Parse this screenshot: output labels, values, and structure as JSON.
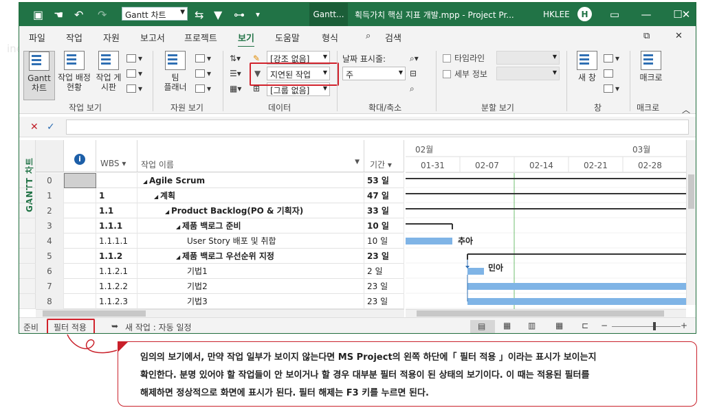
{
  "titlebar": {
    "view_combo": "Gantt 차트",
    "active_tab": "Gantt...",
    "file_title": "획득가치 핵심 지표 개발.mpp - Project Pr...",
    "user": "HKLEE",
    "avatar": "H"
  },
  "menu": [
    "파일",
    "작업",
    "자원",
    "보고서",
    "프로젝트",
    "보기",
    "도움말",
    "형식"
  ],
  "menu_active": "보기",
  "search": "검색",
  "ribbon": {
    "gantt_btn": "Gantt\n차트",
    "task_usage": "작업 배정\n현황",
    "task_sheet": "작업 게\n시판",
    "team_planner": "팀\n플래너",
    "highlight": "[강조 없음]",
    "filter": "지연된 작업",
    "group": "[그룹 없음]",
    "date_scale_label": "날짜 표시줄:",
    "date_scale": "주",
    "timeline": "타임라인",
    "details": "세부 정보",
    "new_window": "새 창",
    "macro": "매크로",
    "groups": [
      "작업 보기",
      "자원 보기",
      "데이터",
      "확대/축소",
      "분할 보기",
      "창",
      "매크로"
    ]
  },
  "grid": {
    "headers": {
      "wbs": "WBS",
      "name": "작업 이름",
      "duration": "기간"
    },
    "rows": [
      {
        "n": "0",
        "wbs": "",
        "name": "Agile Scrum",
        "dur": "53 일",
        "bold": true,
        "indent": 0,
        "summary": true
      },
      {
        "n": "1",
        "wbs": "1",
        "name": "계획",
        "dur": "47 일",
        "bold": true,
        "indent": 1,
        "summary": true
      },
      {
        "n": "2",
        "wbs": "1.1",
        "name": "Product Backlog(PO & 기획자)",
        "dur": "33 일",
        "bold": true,
        "indent": 2,
        "summary": true
      },
      {
        "n": "3",
        "wbs": "1.1.1",
        "name": "제품 백로그 준비",
        "dur": "10 일",
        "bold": true,
        "indent": 3,
        "summary": true
      },
      {
        "n": "4",
        "wbs": "1.1.1.1",
        "name": "User Story 배포 및 취합",
        "dur": "10 일",
        "bold": false,
        "indent": 4,
        "summary": false
      },
      {
        "n": "5",
        "wbs": "1.1.2",
        "name": "제품 백로그  우선순위 지정",
        "dur": "23 일",
        "bold": true,
        "indent": 3,
        "summary": true
      },
      {
        "n": "6",
        "wbs": "1.1.2.1",
        "name": "기법1",
        "dur": "2 일",
        "bold": false,
        "indent": 4,
        "summary": false
      },
      {
        "n": "7",
        "wbs": "1.1.2.2",
        "name": "기법2",
        "dur": "23 일",
        "bold": false,
        "indent": 4,
        "summary": false
      },
      {
        "n": "8",
        "wbs": "1.1.2.3",
        "name": "기법3",
        "dur": "23 일",
        "bold": false,
        "indent": 4,
        "summary": false
      }
    ]
  },
  "gantt": {
    "months": [
      {
        "label": "02월"
      },
      {
        "label": "03월"
      }
    ],
    "weeks": [
      "01-31",
      "02-07",
      "02-14",
      "02-21",
      "02-28"
    ],
    "labels": {
      "row4": "추아",
      "row6": "민아"
    }
  },
  "side_label": "GANTT 차트",
  "status": {
    "ready": "준비",
    "filter": "필터 적용",
    "new_task": "새 작업 : 자동 일정"
  },
  "callout": {
    "line1": "임의의 보기에서, 만약 작업 일부가 보이지 않는다면 MS Project의 왼쪽 하단에「 필터 적용 」이라는 표시가 보이는지",
    "line2": "확인한다. 분명 있어야 할 작업들이 안 보이거나 할 경우 대부분 필터 적용이 된 상태의 보기이다. 이 때는 적용된 필터를",
    "line3": "해제하면 정상적으로 화면에 표시가 된다. 필터 해제는 F3 키를 누르면 된다."
  },
  "colors": {
    "accent": "#217346",
    "highlight_red": "#d1212b",
    "bar": "#7fb4e6"
  }
}
